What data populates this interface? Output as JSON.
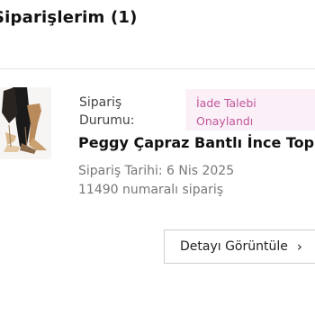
{
  "header": {
    "title": "Siparişlerim (1)"
  },
  "order": {
    "status_label_line1": "Sipariş",
    "status_label_line2": "Durumu:",
    "status_line1": "İade Talebi",
    "status_line2": "Onaylandı",
    "product_name": "Peggy Çapraz Bantlı İnce Topu...",
    "date_text": "Sipariş Tarihi: 6 Nis 2025",
    "number_text": "11490 numaralı sipariş",
    "detail_button_label": "Detayı Görüntüle",
    "detail_icon": "chevron-right-icon",
    "product_image": "product-thumbnail"
  },
  "colors": {
    "badge_bg": "#fbf0f7",
    "badge_text": "#c0569b",
    "title": "#111111",
    "muted": "#777777"
  }
}
